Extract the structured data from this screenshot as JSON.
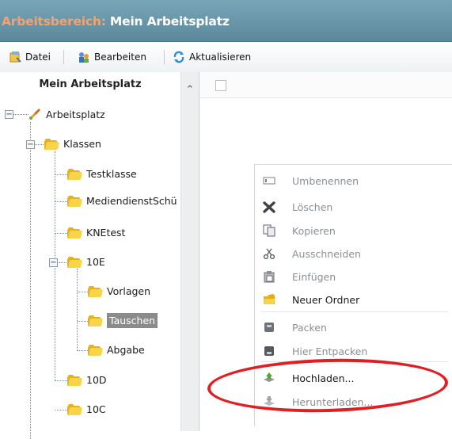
{
  "window": {
    "title_prefix": "Arbeitsbereich:",
    "title_main": "Mein Arbeitsplatz"
  },
  "toolbar": {
    "buttons": [
      {
        "label": "Datei",
        "icon": "file-menu-icon"
      },
      {
        "label": "Bearbeiten",
        "icon": "edit-people-icon"
      },
      {
        "label": "Aktualisieren",
        "icon": "refresh-icon"
      }
    ]
  },
  "sidebar": {
    "title": "Mein Arbeitsplatz",
    "tree": {
      "root": "Arbeitsplatz",
      "klassen": "Klassen",
      "testklasse": "Testklasse",
      "mediendienst": "MediendienstSchü",
      "knetest": "KNEtest",
      "10e": "10E",
      "vorlagen": "Vorlagen",
      "tauschen": "Tauschen",
      "abgabe": "Abgabe",
      "10d": "10D",
      "10c": "10C"
    },
    "selected": "Tauschen"
  },
  "context_menu": {
    "items": [
      {
        "label": "Umbenennen",
        "icon": "rename-icon",
        "enabled": false
      },
      {
        "label": "Löschen",
        "icon": "delete-icon",
        "enabled": false
      },
      {
        "label": "Kopieren",
        "icon": "copy-icon",
        "enabled": false
      },
      {
        "label": "Ausschneiden",
        "icon": "scissors-icon",
        "enabled": false
      },
      {
        "label": "Einfügen",
        "icon": "paste-icon",
        "enabled": false
      },
      {
        "label": "Neuer Ordner",
        "icon": "new-folder-icon",
        "enabled": true
      },
      {
        "label": "Packen",
        "icon": "pack-icon",
        "enabled": false
      },
      {
        "label": "Hier Entpacken",
        "icon": "unpack-icon",
        "enabled": false
      },
      {
        "label": "Hochladen...",
        "icon": "upload-icon",
        "enabled": true
      },
      {
        "label": "Herunterladen...",
        "icon": "download-icon",
        "enabled": false
      }
    ]
  },
  "colors": {
    "title_bar": "#6b96aa",
    "title_prefix": "#f6a26b",
    "highlight_ring": "#e11f23",
    "folder": "#f8d448",
    "selection": "#8b8b8b"
  }
}
